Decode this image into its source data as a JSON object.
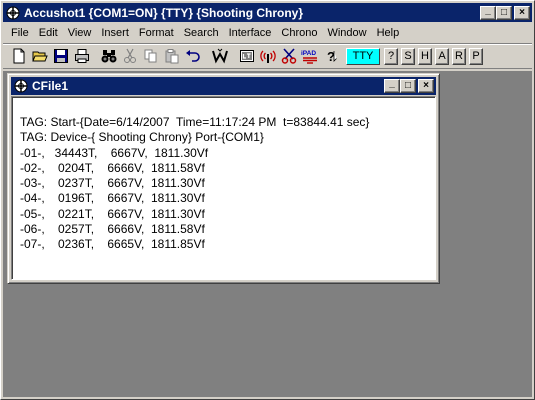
{
  "app": {
    "title": "Accushot1 {COM1=ON} {TTY}  {Shooting Chrony}",
    "caption_minimize": "_",
    "caption_maximize": "□",
    "caption_close": "×"
  },
  "menu": [
    "File",
    "Edit",
    "View",
    "Insert",
    "Format",
    "Search",
    "Interface",
    "Chrono",
    "Window",
    "Help"
  ],
  "toolbar": {
    "icons": [
      "new-file-icon",
      "open-folder-icon",
      "save-icon",
      "print-icon",
      "find-binoculars-icon",
      "cut-icon",
      "copy-icon",
      "paste-icon",
      "undo-icon",
      "w-icon",
      "lt-icon",
      "radar-icon",
      "scissors-icon",
      "ipad-icon",
      "help-icon"
    ],
    "ipad_label": "iPAD",
    "tty_label": "TTY",
    "letters": [
      "?",
      "S",
      "H",
      "A",
      "R",
      "P"
    ]
  },
  "child": {
    "title": "CFile1",
    "lines": [
      "TAG: Start-{Date=6/14/2007  Time=11:17:24 PM  t=83844.41 sec}",
      "TAG: Device-{ Shooting Chrony} Port-{COM1}",
      "-01-,   34443T,    6667V,  1811.30Vf",
      "-02-,    0204T,    6666V,  1811.58Vf",
      "-03-,    0237T,    6667V,  1811.30Vf",
      "-04-,    0196T,    6667V,  1811.30Vf",
      "-05-,    0221T,    6667V,  1811.30Vf",
      "-06-,    0257T,    6666V,  1811.58Vf",
      "-07-,    0236T,    6665V,  1811.85Vf"
    ]
  }
}
